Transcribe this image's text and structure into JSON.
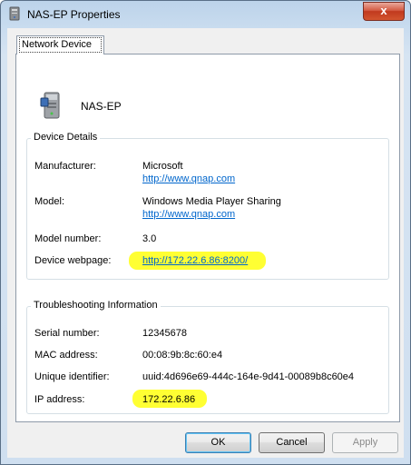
{
  "window": {
    "title": "NAS-EP Properties",
    "close_label": "x"
  },
  "tabs": [
    {
      "label": "Network Device"
    }
  ],
  "device": {
    "name": "NAS-EP",
    "icon": "nas-device-icon"
  },
  "device_details": {
    "title": "Device Details",
    "manufacturer_label": "Manufacturer:",
    "manufacturer_value": "Microsoft",
    "manufacturer_link": "http://www.qnap.com",
    "model_label": "Model:",
    "model_value": "Windows Media Player Sharing",
    "model_link": "http://www.qnap.com",
    "model_number_label": "Model number:",
    "model_number_value": "3.0",
    "webpage_label": "Device webpage:",
    "webpage_value": "http://172.22.6.86:8200/"
  },
  "troubleshooting": {
    "title": "Troubleshooting Information",
    "serial_label": "Serial number:",
    "serial_value": "12345678",
    "mac_label": "MAC address:",
    "mac_value": "00:08:9b:8c:60:e4",
    "uid_label": "Unique identifier:",
    "uid_value": "uuid:4d696e69-444c-164e-9d41-00089b8c60e4",
    "ip_label": "IP address:",
    "ip_value": "172.22.6.86"
  },
  "buttons": {
    "ok": "OK",
    "cancel": "Cancel",
    "apply": "Apply"
  },
  "colors": {
    "highlight": "#ffff33",
    "link": "#0066cc",
    "close": "#c1391e"
  }
}
